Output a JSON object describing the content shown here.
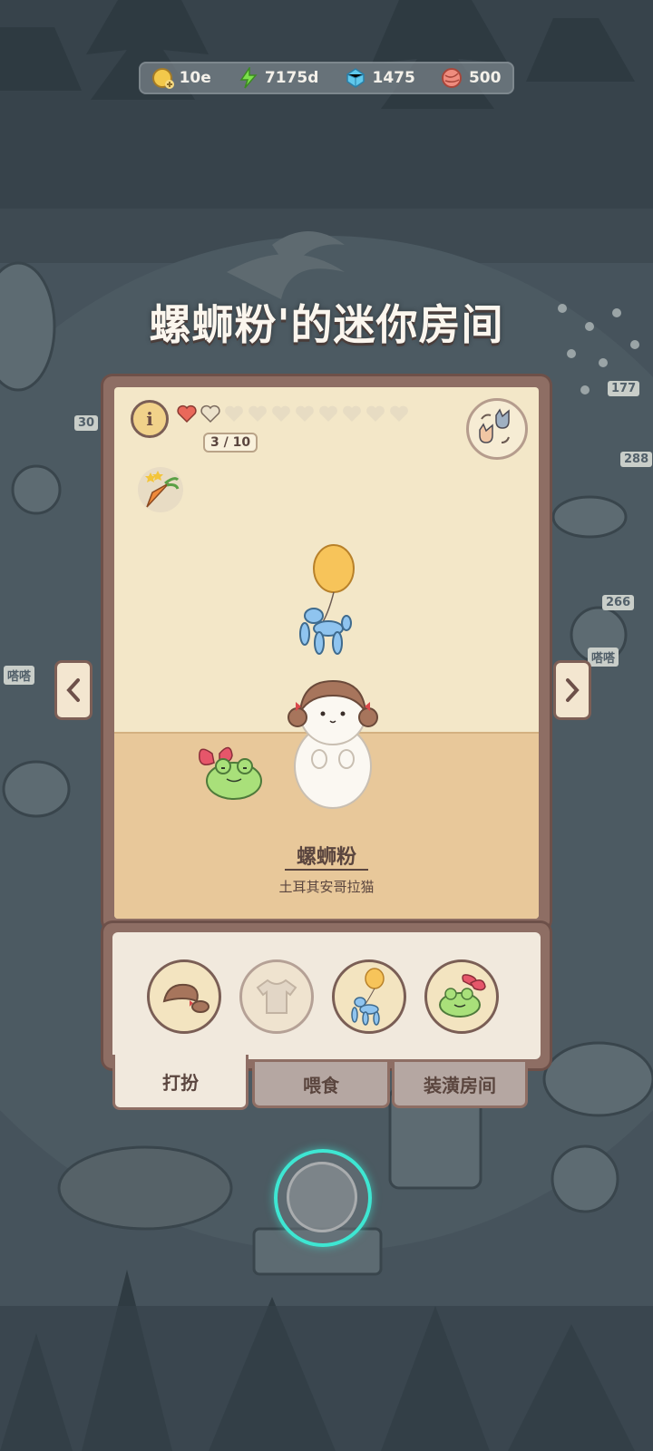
{
  "resources": [
    {
      "icon": "coin-icon",
      "value": "10e"
    },
    {
      "icon": "lightning-icon",
      "value": "7175d"
    },
    {
      "icon": "gem-icon",
      "value": "1475"
    },
    {
      "icon": "yarn-icon",
      "value": "500"
    }
  ],
  "room_title": "螺蛳粉'的迷你房间",
  "info_label": "i",
  "affection": {
    "filled": 1,
    "total": 10,
    "label": "3 / 10"
  },
  "pet": {
    "name": "螺蛳粉",
    "breed": "土耳其安哥拉猫"
  },
  "items": [
    {
      "name": "hair-item"
    },
    {
      "name": "shirt-item"
    },
    {
      "name": "balloon-dog-item"
    },
    {
      "name": "frog-plush-item"
    }
  ],
  "tabs": [
    {
      "label": "打扮",
      "active": true
    },
    {
      "label": "喂食",
      "active": false
    },
    {
      "label": "装潢房间",
      "active": false
    }
  ],
  "bg_labels": [
    "177",
    "288",
    "266",
    "30",
    "嗒嗒",
    "嗒嗒"
  ]
}
